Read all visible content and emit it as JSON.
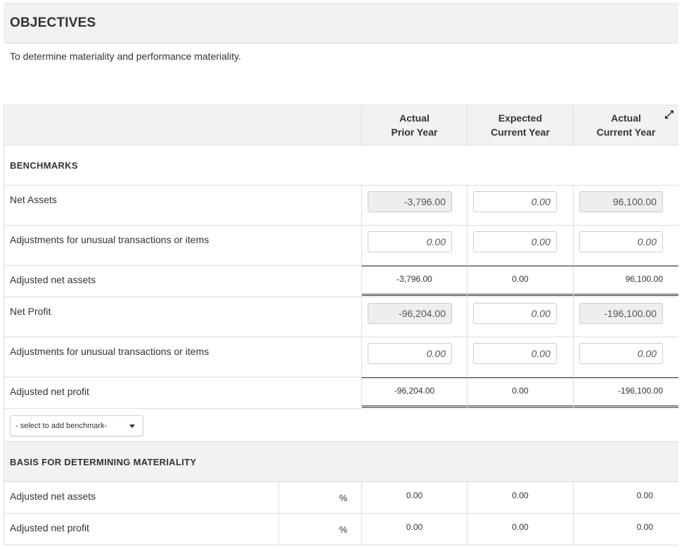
{
  "objectives": {
    "title": "OBJECTIVES",
    "description": "To determine materiality and performance materiality."
  },
  "table": {
    "columns": [
      {
        "line1": "Actual",
        "line2": "Prior Year"
      },
      {
        "line1": "Expected",
        "line2": "Current Year"
      },
      {
        "line1": "Actual",
        "line2": "Current Year"
      }
    ],
    "expand_icon": "expand-icon",
    "benchmarks_title": "BENCHMARKS",
    "rows": {
      "net_assets": {
        "label": "Net Assets",
        "prior": "-3,796.00",
        "expected": "0.00",
        "actual": "96,100.00"
      },
      "adj_assets": {
        "label": "Adjustments for unusual transactions or items",
        "prior": "0.00",
        "expected": "0.00",
        "actual": "0.00"
      },
      "adjusted_net_assets": {
        "label": "Adjusted net assets",
        "prior": "-3,796.00",
        "expected": "0.00",
        "actual": "96,100.00"
      },
      "net_profit": {
        "label": "Net Profit",
        "prior": "-96,204.00",
        "expected": "0.00",
        "actual": "-196,100.00"
      },
      "adj_profit": {
        "label": "Adjustments for unusual transactions or items",
        "prior": "0.00",
        "expected": "0.00",
        "actual": "0.00"
      },
      "adjusted_net_profit": {
        "label": "Adjusted net profit",
        "prior": "-96,204.00",
        "expected": "0.00",
        "actual": "-196,100.00"
      }
    },
    "add_benchmark_select": "- select to add benchmark-",
    "basis_title": "BASIS FOR DETERMINING MATERIALITY",
    "basis_rows": [
      {
        "label": "Adjusted net assets",
        "unit": "%",
        "prior": "0.00",
        "expected": "0.00",
        "actual": "0.00"
      },
      {
        "label": "Adjusted net profit",
        "unit": "%",
        "prior": "0.00",
        "expected": "0.00",
        "actual": "0.00"
      }
    ]
  }
}
